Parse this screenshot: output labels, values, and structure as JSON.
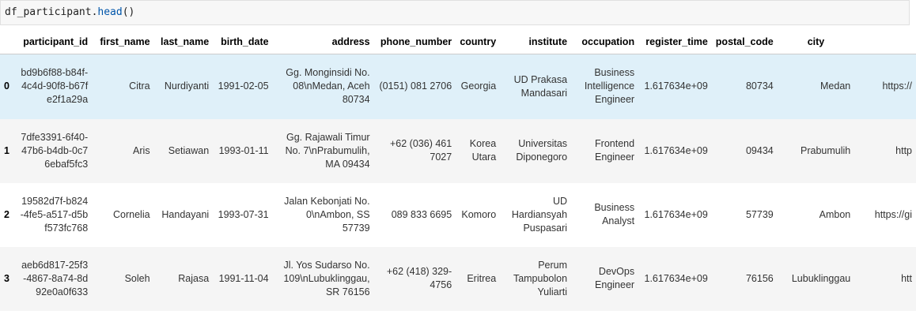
{
  "code_cell": {
    "var": "df_participant",
    "dot": ".",
    "method": "head",
    "parens": "()"
  },
  "table": {
    "columns": [
      "",
      "participant_id",
      "first_name",
      "last_name",
      "birth_date",
      "address",
      "phone_number",
      "country",
      "institute",
      "occupation",
      "register_time",
      "postal_code",
      "city",
      ""
    ],
    "rows": [
      {
        "index": "0",
        "participant_id": "bd9b6f88-b84f-4c4d-90f8-b67fe2f1a29a",
        "first_name": "Citra",
        "last_name": "Nurdiyanti",
        "birth_date": "1991-02-05",
        "address": "Gg. Monginsidi No. 08\\nMedan, Aceh 80734",
        "phone_number": "(0151) 081 2706",
        "country": "Georgia",
        "institute": "UD Prakasa Mandasari",
        "occupation": "Business Intelligence Engineer",
        "register_time": "1.617634e+09",
        "postal_code": "80734",
        "city": "Medan",
        "extra": "https://"
      },
      {
        "index": "1",
        "participant_id": "7dfe3391-6f40-47b6-b4db-0c76ebaf5fc3",
        "first_name": "Aris",
        "last_name": "Setiawan",
        "birth_date": "1993-01-11",
        "address": "Gg. Rajawali Timur No. 7\\nPrabumulih, MA 09434",
        "phone_number": "+62 (036) 461 7027",
        "country": "Korea Utara",
        "institute": "Universitas Diponegoro",
        "occupation": "Frontend Engineer",
        "register_time": "1.617634e+09",
        "postal_code": "09434",
        "city": "Prabumulih",
        "extra": "http"
      },
      {
        "index": "2",
        "participant_id": "19582d7f-b824-4fe5-a517-d5bf573fc768",
        "first_name": "Cornelia",
        "last_name": "Handayani",
        "birth_date": "1993-07-31",
        "address": "Jalan Kebonjati No. 0\\nAmbon, SS 57739",
        "phone_number": "089 833 6695",
        "country": "Komoro",
        "institute": "UD Hardiansyah Puspasari",
        "occupation": "Business Analyst",
        "register_time": "1.617634e+09",
        "postal_code": "57739",
        "city": "Ambon",
        "extra": "https://gi"
      },
      {
        "index": "3",
        "participant_id": "aeb6d817-25f3-4867-8a74-8d92e0a0f633",
        "first_name": "Soleh",
        "last_name": "Rajasa",
        "birth_date": "1991-11-04",
        "address": "Jl. Yos Sudarso No. 109\\nLubuklinggau, SR 76156",
        "phone_number": "+62 (418) 329-4756",
        "country": "Eritrea",
        "institute": "Perum Tampubolon Yuliarti",
        "occupation": "DevOps Engineer",
        "register_time": "1.617634e+09",
        "postal_code": "76156",
        "city": "Lubuklinggau",
        "extra": "htt"
      }
    ]
  }
}
